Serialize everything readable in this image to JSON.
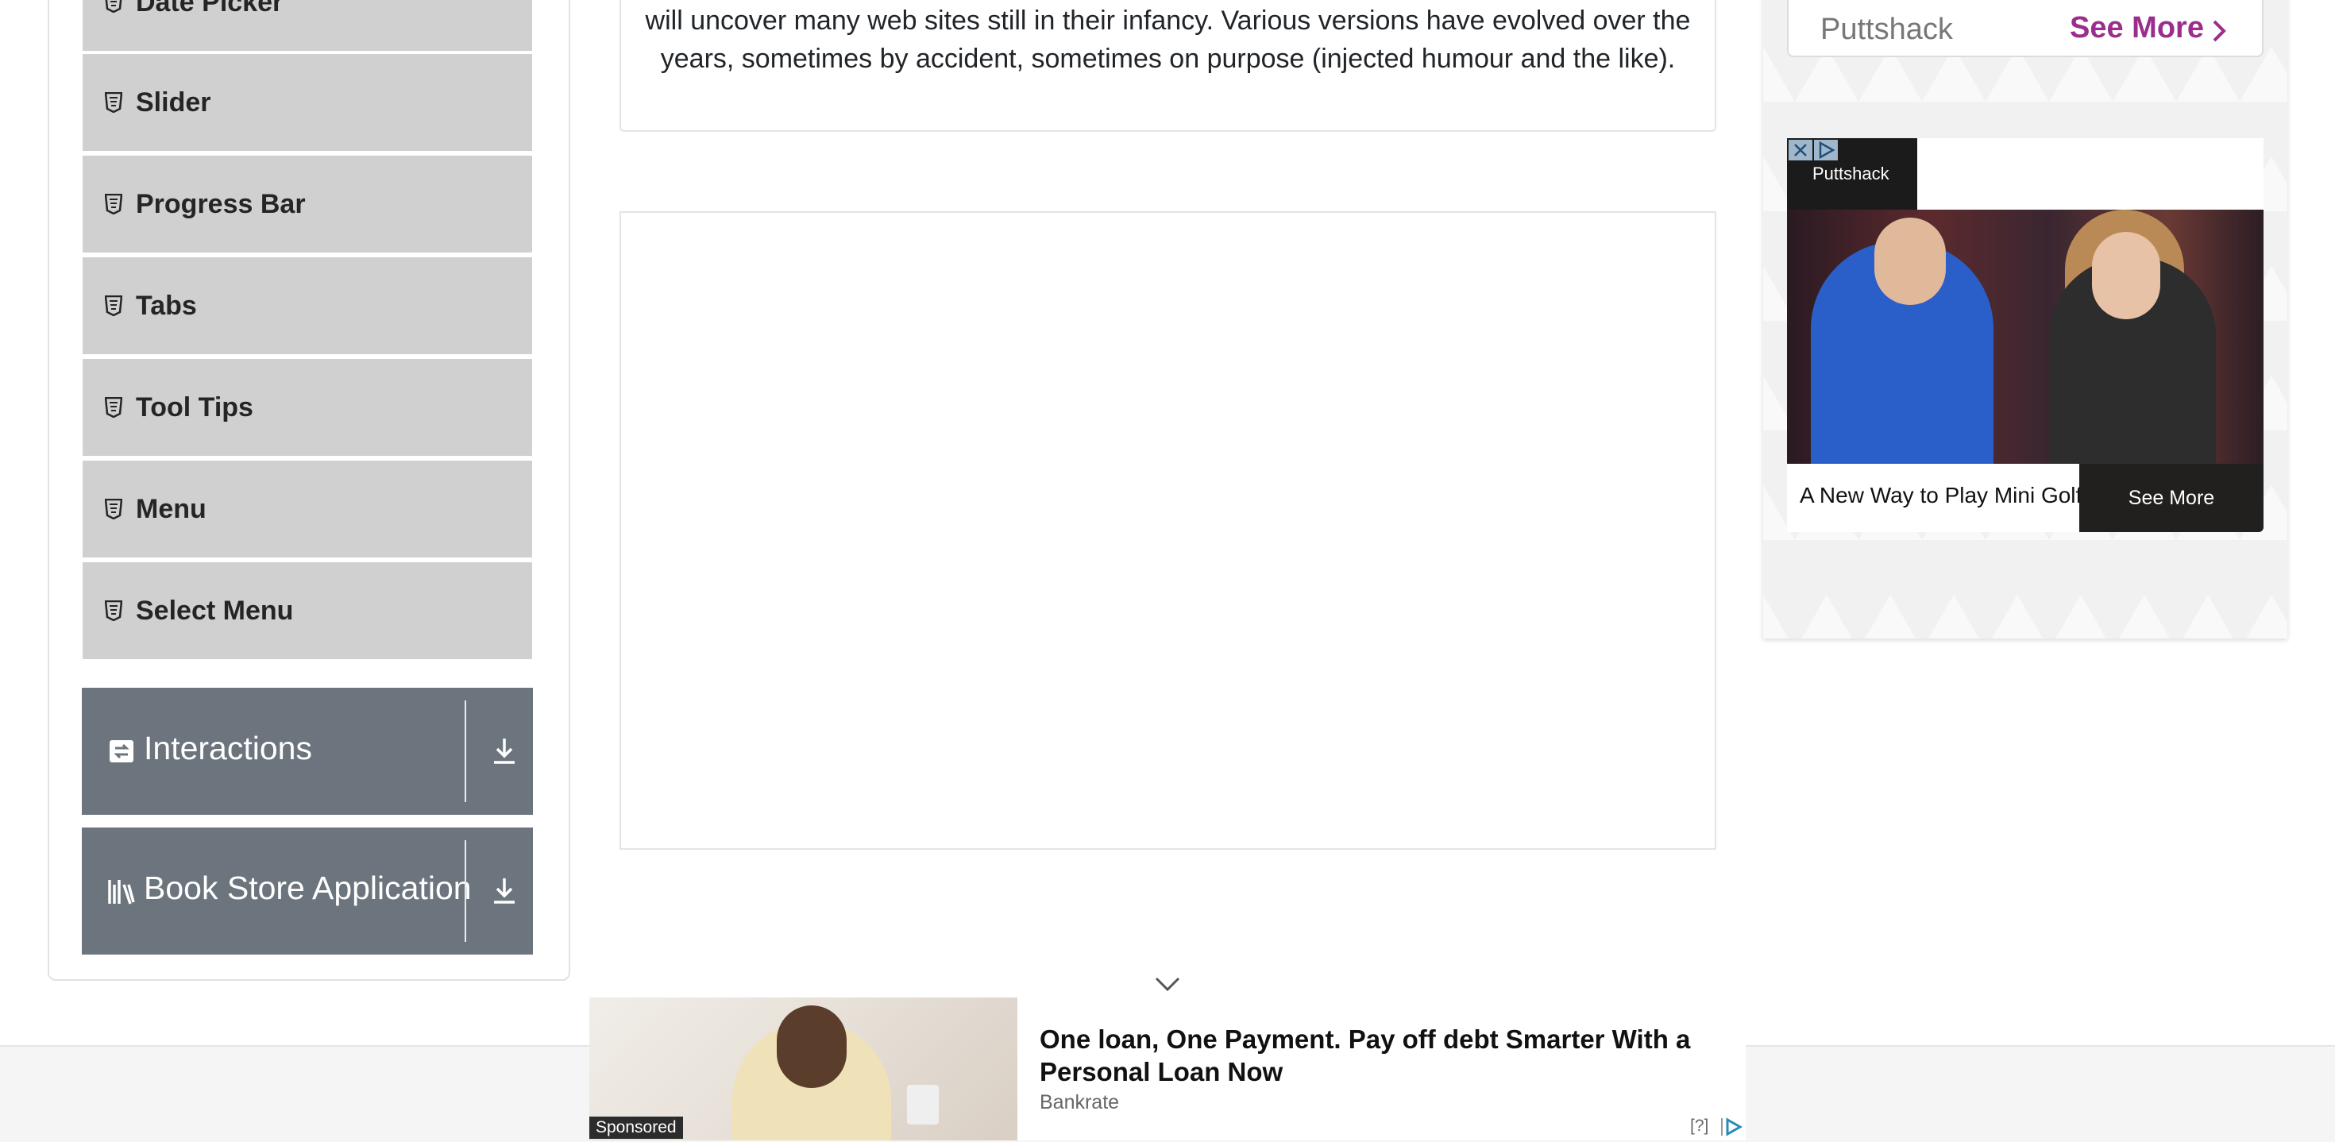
{
  "sidebar": {
    "elements_items": [
      {
        "label": "Date Picker",
        "icon": "html5-shield-icon"
      },
      {
        "label": "Slider",
        "icon": "html5-shield-icon"
      },
      {
        "label": "Progress Bar",
        "icon": "html5-shield-icon"
      },
      {
        "label": "Tabs",
        "icon": "html5-shield-icon"
      },
      {
        "label": "Tool Tips",
        "icon": "html5-shield-icon"
      },
      {
        "label": "Menu",
        "icon": "html5-shield-icon"
      },
      {
        "label": "Select Menu",
        "icon": "html5-shield-icon"
      }
    ],
    "groups": [
      {
        "label": "Interactions",
        "icon": "interactions-icon"
      },
      {
        "label": "Book Store Application",
        "icon": "books-icon"
      }
    ]
  },
  "main": {
    "text": "will uncover many web sites still in their infancy. Various versions have evolved over the years, sometimes by accident, sometimes on purpose (injected humour and the like)."
  },
  "ad_right": {
    "top_bar": {
      "brand": "Puttshack",
      "cta": "See More"
    },
    "card": {
      "brand": "Puttshack",
      "caption": "A New Way to Play Mini Golf",
      "cta": "See More"
    }
  },
  "ad_bottom": {
    "sponsored_label": "Sponsored",
    "headline": "One loan, One Payment. Pay off debt Smarter With a Personal Loan Now",
    "advertiser": "Bankrate",
    "help": "[?]"
  },
  "colors": {
    "menu_item_bg": "#d0d0d0",
    "group_bg": "#6c757d",
    "ad_link": "#9b2d8d"
  }
}
